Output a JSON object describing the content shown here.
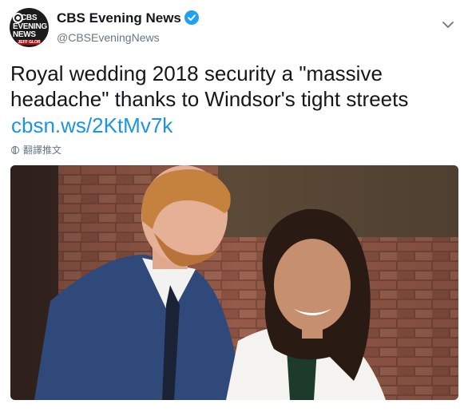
{
  "account": {
    "display_name": "CBS Evening News",
    "handle": "@CBSEveningNews",
    "verified": true,
    "avatar": {
      "line1": "CBS",
      "line2": "EVENING",
      "line3": "NEWS",
      "strip": "JEFF GLOR"
    }
  },
  "tweet": {
    "text": "Royal wedding 2018 security a \"massive headache\" thanks to Windsor's tight streets",
    "link": "cbsn.ws/2KtMv7k",
    "translate_label": "翻譯推文"
  },
  "media": {
    "type": "photo",
    "alt": ""
  },
  "icons": {
    "verified": "verified-badge-icon",
    "menu": "chevron-down-icon",
    "translate": "globe-icon"
  },
  "colors": {
    "link": "#1b95e0",
    "verified": "#1da1f2",
    "secondary_text": "#657786"
  }
}
